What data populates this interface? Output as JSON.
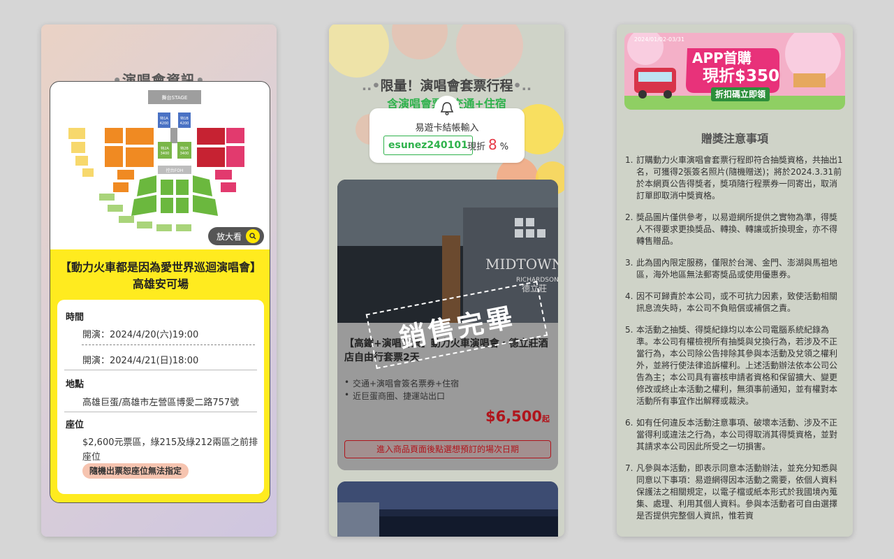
{
  "panel1": {
    "title": "演唱會資訊",
    "map": {
      "stage": "舞台STAGE",
      "foh": "控台FOH",
      "zoom_label": "放大看",
      "sections": [
        {
          "name": "特1A",
          "price": "4200"
        },
        {
          "name": "特1B",
          "price": "4200"
        },
        {
          "name": "特2A",
          "price": "3400"
        },
        {
          "name": "特2B",
          "price": "3400"
        }
      ]
    },
    "event_title": "【動力火車都是因為愛世界巡迴演唱會】高雄安可場",
    "time_label": "時間",
    "time1": "開演：2024/4/20(六)19:00",
    "time2": "開演：2024/4/21(日)18:00",
    "place_label": "地點",
    "place": "高雄巨蛋/高雄市左營區博愛二路757號",
    "seat_label": "座位",
    "seat_line1": "$2,600元票區，綠215及綠212兩區之前排",
    "seat_line2": "座位",
    "seat_badge": "隨機出票恕座位無法指定"
  },
  "panel2": {
    "title": "限量！演唱會套票行程",
    "subtitle": "含演唱會票+交通+住宿",
    "coupon_label": "易遊卡結帳輸入",
    "coupon_code": "esunez240101",
    "discount_prefix": "現折",
    "discount_value": "8",
    "discount_unit": "%",
    "product_title": "【高鐵+演唱會票】動力火車演唱會・德立莊酒店自由行套票2天",
    "bullets": [
      "交通+演唱會簽名票券+住宿",
      "近巨蛋商圈、捷運站出口"
    ],
    "price": "$6,500",
    "price_suffix": "起",
    "button": "進入商品頁面後點選想預訂的場次日期",
    "stamp": "銷售完畢",
    "hotel_sign1": "MIDTOWN",
    "hotel_sign2": "RICHARDSON",
    "hotel_sign3": "德立莊"
  },
  "panel3": {
    "banner": {
      "date": "2024/01/02-03/31",
      "line1": "APP首購",
      "line2": "現折$350",
      "line3": "折扣碼立即領"
    },
    "heading": "贈獎注意事項",
    "rules": [
      "訂購動力火車演唱會套票行程即符合抽獎資格，共抽出1名，可獲得2張簽名照片(隨機贈送)；將於2024.3.31前於本網頁公告得獎者，獎項隨行程票券一同寄出，取消訂單即取消中獎資格。",
      "獎品圖片僅供參考，以易遊網所提供之實物為準，得獎人不得要求更換獎品、轉換、轉讓或折換現金，亦不得轉售贈品。",
      "此為國內限定服務，僅限於台灣、金門、澎湖與馬祖地區，海外地區無法郵寄獎品或使用優惠券。",
      "因不可歸責於本公司，或不可抗力因素，致使活動相關訊息流失時，本公司不負賠償或補償之責。",
      "本活動之抽獎、得獎紀錄均以本公司電腦系統紀錄為準。本公司有權檢視所有抽獎與兌換行為，若涉及不正當行為，本公司除公告排除其參與本活動及兌領之權利外，並將行使法律追訴權利。上述活動辦法依本公司公告為主；本公司具有審核申請者資格和保留擴大、變更修改或終止本活動之權利，無須事前通知，並有權對本活動所有事宜作出解釋或裁決。",
      "如有任何違反本活動注意事項、破壞本活動、涉及不正當得利或違法之行為，本公司得取消其得獎資格，並對其請求本公司因此所受之一切損害。",
      "凡參與本活動，即表示同意本活動辦法，並充分知悉與同意以下事項：易遊網得因本活動之需要，依個人資料保護法之相關規定，以電子檔或紙本形式於我國境內蒐集、處理、利用其個人資料。參與本活動者可自由選擇是否提供完整個人資訊，惟若資"
    ]
  }
}
